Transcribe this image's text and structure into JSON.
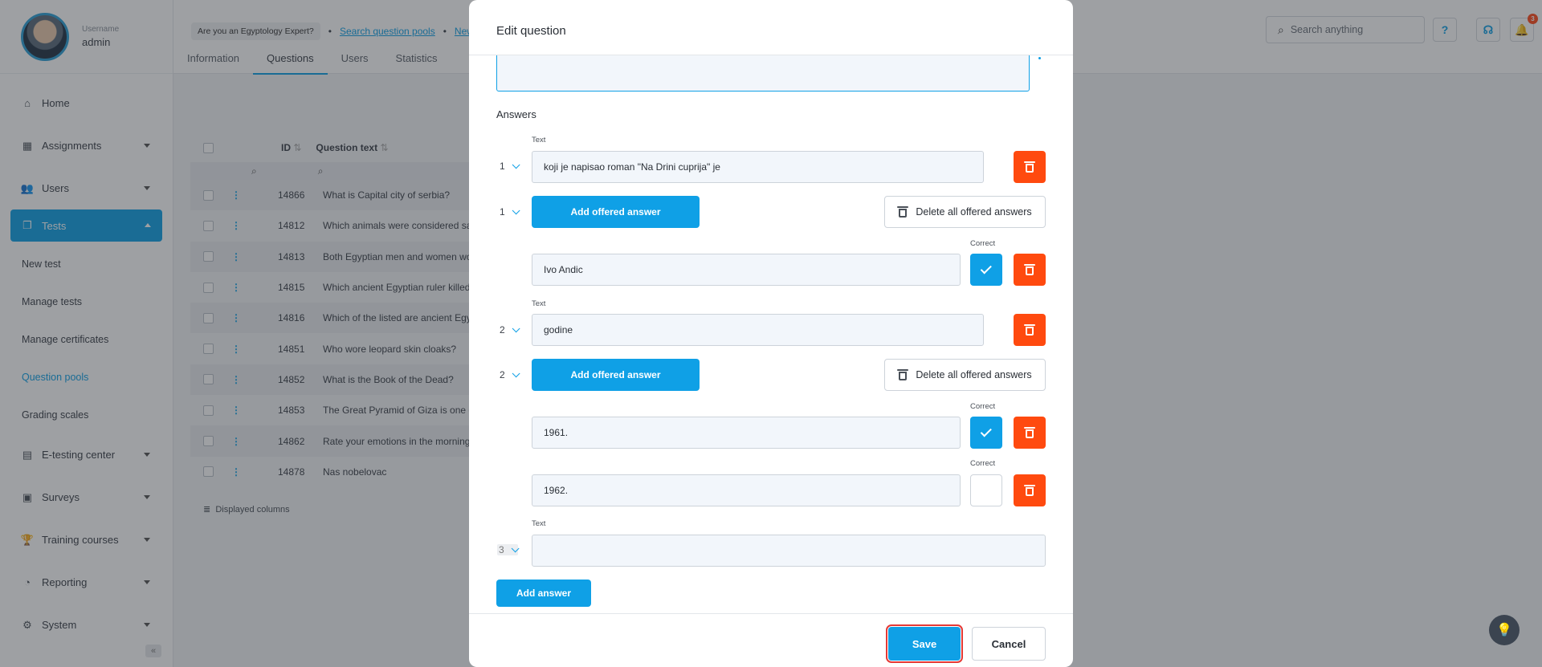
{
  "user": {
    "label": "Username",
    "name": "admin"
  },
  "sidebar": {
    "items": [
      {
        "label": "Home",
        "icon": "home-icon"
      },
      {
        "label": "Assignments",
        "icon": "dashboard-icon"
      },
      {
        "label": "Users",
        "icon": "users-icon"
      },
      {
        "label": "Tests",
        "icon": "tests-icon"
      },
      {
        "label": "E-testing center",
        "icon": "e-testing-icon"
      },
      {
        "label": "Surveys",
        "icon": "surveys-icon"
      },
      {
        "label": "Training courses",
        "icon": "trophy-icon"
      },
      {
        "label": "Reporting",
        "icon": "reporting-icon"
      },
      {
        "label": "System",
        "icon": "gear-icon"
      }
    ],
    "sub_items": [
      "New test",
      "Manage tests",
      "Manage certificates",
      "Question pools",
      "Grading scales"
    ]
  },
  "breadcrumb": {
    "pill": "Are you an Egyptology Expert?",
    "link1": "Search question pools",
    "link2": "New"
  },
  "tabs": [
    "Information",
    "Questions",
    "Users",
    "Statistics"
  ],
  "search": {
    "placeholder": "Search anything"
  },
  "notifications": {
    "count": "3"
  },
  "table": {
    "headers": {
      "id": "ID",
      "text": "Question text"
    },
    "rows": [
      {
        "id": "14866",
        "text": "What is Capital city of serbia?"
      },
      {
        "id": "14812",
        "text": "Which animals were considered sac"
      },
      {
        "id": "14813",
        "text": "Both Egyptian men and women wore"
      },
      {
        "id": "14815",
        "text": "Which ancient Egyptian ruler killed t"
      },
      {
        "id": "14816",
        "text": "Which of the listed are ancient Egyp"
      },
      {
        "id": "14851",
        "text": "Who wore leopard skin cloaks?"
      },
      {
        "id": "14852",
        "text": "What is the Book of the Dead?"
      },
      {
        "id": "14853",
        "text": "The Great Pyramid of Giza is one of"
      },
      {
        "id": "14862",
        "text": "Rate your emotions in the morning."
      },
      {
        "id": "14878",
        "text": "Nas nobelovac"
      }
    ],
    "displayed_columns": "Displayed columns"
  },
  "modal": {
    "title": "Edit question",
    "answers_heading": "Answers",
    "text_label": "Text",
    "correct_label": "Correct",
    "add_offered_label": "Add offered answer",
    "delete_all_label": "Delete all offered answers",
    "answers": [
      {
        "num": "1",
        "text": "koji je napisao roman \"Na Drini cuprija\" je",
        "offered": [
          {
            "text": "Ivo Andic",
            "correct": true
          }
        ]
      },
      {
        "num": "2",
        "text": "godine",
        "offered": [
          {
            "text": "1961.",
            "correct": true
          },
          {
            "text": "1962.",
            "correct": false
          }
        ]
      },
      {
        "num": "3",
        "text": ""
      }
    ],
    "add_answer_label": "Add answer",
    "save_label": "Save",
    "cancel_label": "Cancel"
  }
}
